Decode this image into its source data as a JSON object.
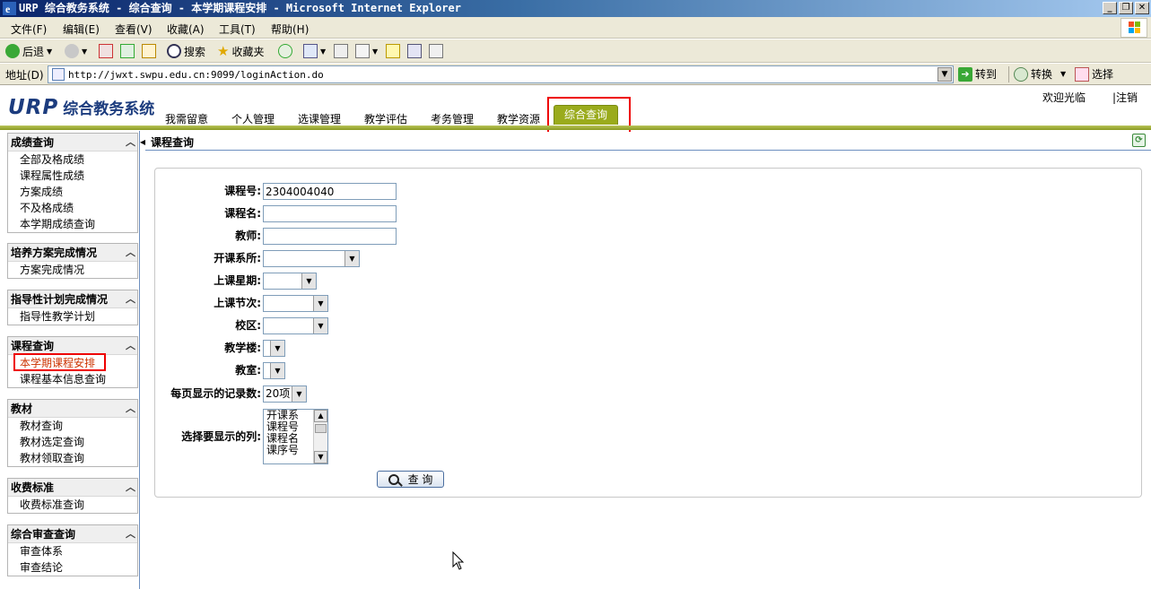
{
  "window": {
    "title": "URP 综合教务系统 - 综合查询 - 本学期课程安排 - Microsoft Internet Explorer",
    "buttons": [
      "_",
      "❐",
      "✕"
    ]
  },
  "menu": [
    "文件(F)",
    "编辑(E)",
    "查看(V)",
    "收藏(A)",
    "工具(T)",
    "帮助(H)"
  ],
  "toolbar": {
    "back": "后退",
    "search": "搜索",
    "favorites": "收藏夹"
  },
  "address": {
    "label": "地址(D)",
    "url": "http://jwxt.swpu.edu.cn:9099/loginAction.do",
    "go": "转到",
    "switch": "转换",
    "select": "选择"
  },
  "header": {
    "logo_brand": "URP",
    "logo_text": "综合教务系统",
    "welcome": "欢迎光临",
    "logout": "|注销",
    "tabs": [
      "我需留意",
      "个人管理",
      "选课管理",
      "教学评估",
      "考务管理",
      "教学资源"
    ],
    "active_tab": "综合查询"
  },
  "sidebar": {
    "groups": [
      {
        "title": "成绩查询",
        "items": [
          "全部及格成绩",
          "课程属性成绩",
          "方案成绩",
          "不及格成绩",
          "本学期成绩查询"
        ]
      },
      {
        "title": "培养方案完成情况",
        "items": [
          "方案完成情况"
        ]
      },
      {
        "title": "指导性计划完成情况",
        "items": [
          "指导性教学计划"
        ]
      },
      {
        "title": "课程查询",
        "items": [
          "本学期课程安排",
          "课程基本信息查询"
        ]
      },
      {
        "title": "教材",
        "items": [
          "教材查询",
          "教材选定查询",
          "教材领取查询"
        ]
      },
      {
        "title": "收费标准",
        "items": [
          "收费标准查询"
        ]
      },
      {
        "title": "综合审查查询",
        "items": [
          "审查体系",
          "审查结论"
        ]
      }
    ]
  },
  "main": {
    "title": "课程查询",
    "form": {
      "course_no_label": "课程号:",
      "course_no_value": "2304004040",
      "course_name_label": "课程名:",
      "course_name_value": "",
      "teacher_label": "教师:",
      "teacher_value": "",
      "dept_label": "开课系所:",
      "dept_value": "",
      "weekday_label": "上课星期:",
      "weekday_value": "",
      "period_label": "上课节次:",
      "period_value": "",
      "campus_label": "校区:",
      "campus_value": "",
      "building_label": "教学楼:",
      "building_value": "",
      "room_label": "教室:",
      "room_value": "",
      "pagesize_label": "每页显示的记录数:",
      "pagesize_value": "20项",
      "columns_label": "选择要显示的列:",
      "columns_options": [
        "开课系",
        "课程号",
        "课程名",
        "课序号"
      ],
      "query_button": "查 询"
    }
  }
}
